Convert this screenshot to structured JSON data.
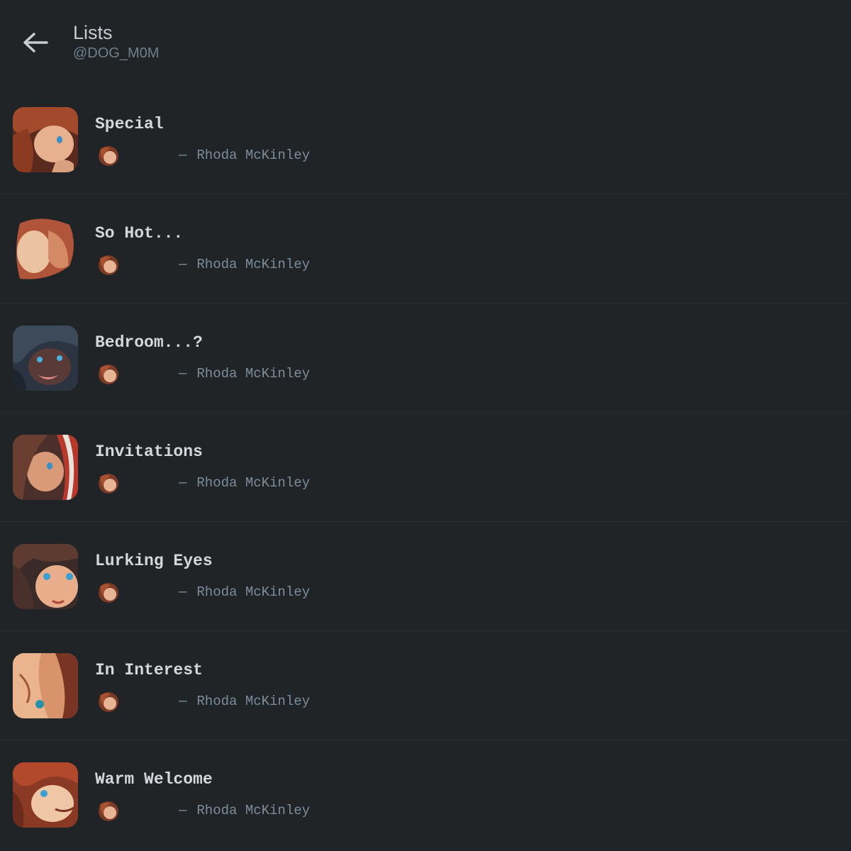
{
  "header": {
    "title": "Lists",
    "handle": "@DOG_M0M",
    "back_icon": "arrow-left-icon"
  },
  "colors": {
    "background": "#212426",
    "divider": "#2c3033",
    "title_text": "#d4d8dc",
    "muted_text": "#7b8d9c"
  },
  "lists": [
    {
      "name": "Special",
      "owner": "Rhoda McKinley",
      "dash": "—"
    },
    {
      "name": "So Hot...",
      "owner": "Rhoda McKinley",
      "dash": "—"
    },
    {
      "name": "Bedroom...?",
      "owner": "Rhoda McKinley",
      "dash": "—"
    },
    {
      "name": "Invitations",
      "owner": "Rhoda McKinley",
      "dash": "—"
    },
    {
      "name": "Lurking Eyes",
      "owner": "Rhoda McKinley",
      "dash": "—"
    },
    {
      "name": "In Interest",
      "owner": "Rhoda McKinley",
      "dash": "—"
    },
    {
      "name": "Warm Welcome",
      "owner": "Rhoda McKinley",
      "dash": "—"
    }
  ]
}
